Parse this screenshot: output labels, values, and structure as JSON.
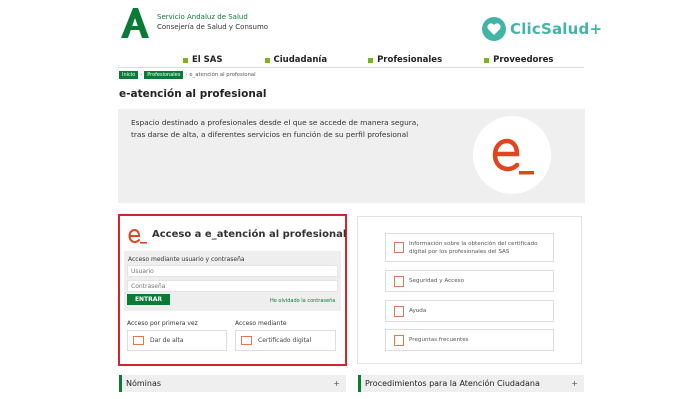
{
  "header": {
    "org_line1": "Servicio Andaluz de Salud",
    "org_line2": "Consejería de Salud y Consumo",
    "clicsalud": "ClicSalud+"
  },
  "nav": [
    "El SAS",
    "Ciudadanía",
    "Profesionales",
    "Proveedores"
  ],
  "breadcrumb": {
    "items": [
      "Inicio",
      "Profesionales"
    ],
    "current": "e_atención al profesional"
  },
  "page_title": "e-atención al profesional",
  "intro": {
    "text": "Espacio destinado a profesionales desde el que se accede de manera segura, tras darse de alta, a diferentes servicios en función de su perfil profesional"
  },
  "login": {
    "title": "Acceso a e_atención al profesional",
    "form_label": "Acceso mediante usuario y contraseña",
    "user_placeholder": "Usuario",
    "pass_placeholder": "Contraseña",
    "submit": "ENTRAR",
    "forgot": "He olvidado la contraseña",
    "first_time_label": "Acceso por primera vez",
    "access_label": "Acceso mediante",
    "signup": "Dar de alta",
    "certificate": "Certificado digital"
  },
  "links": [
    "Información sobre la obtención del certificado digital por los profesionales del SAS",
    "Seguridad y Acceso",
    "Ayuda",
    "Preguntas frecuentes"
  ],
  "accordions": [
    "Nóminas",
    "Procedimientos para la Atención Ciudadana"
  ],
  "colors": {
    "brand_green": "#0a7a37",
    "accent_orange": "#e0461e",
    "nav_bullet": "#7ab51d",
    "highlight_red": "#d3232e",
    "clicsalud_teal": "#41b6a6"
  }
}
